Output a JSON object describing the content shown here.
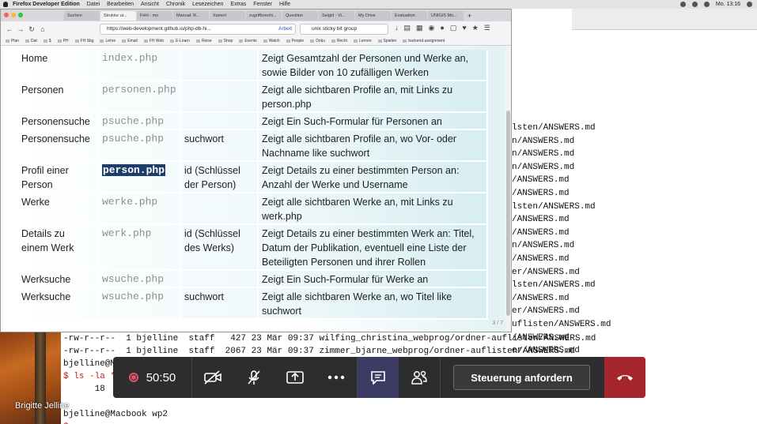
{
  "menubar": {
    "app": "Firefox Developer Edition",
    "items": [
      "Datei",
      "Bearbeiten",
      "Ansicht",
      "Chronik",
      "Lesezeichen",
      "Extras",
      "Fenster",
      "Hilfe"
    ],
    "clock": "Mo. 13:16"
  },
  "browser": {
    "tabs": [
      "Suchen",
      "Struktur ui...",
      "Fehl - mo",
      "Manual: R...",
      "Xameri",
      "zugriffsrecht...",
      "Question",
      "Selgid - Vi...",
      "My Drive",
      "Evaluation",
      "UNIGIS Mo..."
    ],
    "url": "https://web-development.github.io/php-db-hi...",
    "url_tag": "Arbeit",
    "search": "unix sticky bit group",
    "bookmarks": [
      "Plan",
      "Dat",
      "$",
      "PH",
      "FH Sbg",
      "Lehre",
      "Email",
      "FH Web",
      "E-Learn",
      "Reise",
      "Shop",
      "Events",
      "Watch",
      "People",
      "Doku",
      "Recht",
      "Lernen",
      "Spielen",
      "backend-assignment"
    ],
    "page_number": "3 / 7",
    "table": [
      {
        "page": "Home",
        "file": "index.php",
        "param": "",
        "desc": "Zeigt Gesamtzahl der Personen und Werke an, sowie Bilder von 10 zufälligen Werken"
      },
      {
        "page": "Personen",
        "file": "personen.php",
        "param": "",
        "desc": "Zeigt alle sichtbaren Profile an, mit Links zu person.php"
      },
      {
        "page": "Personensuche",
        "file": "psuche.php",
        "param": "",
        "desc": "Zeigt Ein Such-Formular für Personen an"
      },
      {
        "page": "Personensuche",
        "file": "psuche.php",
        "param": "suchwort",
        "desc": "Zeigt alle sichtbaren Profile an, wo Vor- oder Nachname like suchwort"
      },
      {
        "page": "Profil einer Person",
        "file": "person.php",
        "param": "id (Schlüssel der Person)",
        "desc": "Zeigt Details zu einer bestimmten Person an: Anzahl der Werke und Username"
      },
      {
        "page": "Werke",
        "file": "werke.php",
        "param": "",
        "desc": "Zeigt alle sichtbaren Werke an, mit Links zu werk.php"
      },
      {
        "page": "Details zu einem Werk",
        "file": "werk.php",
        "param": "id (Schlüssel des Werks)",
        "desc": "Zeigt Details zu einer bestimmten Werk an: Titel, Datum der Publikation, eventuell eine Liste der Beteiligten Personen und ihrer Rollen"
      },
      {
        "page": "Werksuche",
        "file": "wsuche.php",
        "param": "",
        "desc": "Zeigt Ein Such-Formular für Werke an"
      },
      {
        "page": "Werksuche",
        "file": "wsuche.php",
        "param": "suchwort",
        "desc": "Zeigt alle sichtbaren Werke an, wo Titel like suchwort"
      }
    ]
  },
  "terminal": {
    "lines": [
      "lsten/ANSWERS.md",
      "n/ANSWERS.md",
      "n/ANSWERS.md",
      "n/ANSWERS.md",
      "/ANSWERS.md",
      "/ANSWERS.md",
      "lsten/ANSWERS.md",
      "/ANSWERS.md",
      "/ANSWERS.md",
      "n/ANSWERS.md",
      "/ANSWERS.md",
      "er/ANSWERS.md",
      "lsten/ANSWERS.md",
      "/ANSWERS.md",
      "er/ANSWERS.md",
      "uflisten/ANSWERS.md",
      "/ANSWERS.md",
      "er/ANSWERS.md"
    ],
    "bottom_lines": [
      "-rw-r--r--  1 bjelline  staff   427 23 Mär 09:37 wilfing_christina_webprog/ordner-auflisten/ANSWERS.md",
      "-rw-r--r--  1 bjelline  staff  2067 23 Mär 09:37 zimmer_bjarne_webprog/ordner-auflisten/ANSWERS.md",
      "bjelline@Macbook wp2",
      "$ ls -la *",
      "      18",
      "",
      "bjelline@Macbook wp2",
      "$"
    ]
  },
  "meeting": {
    "participant": "Brigitte Jelline",
    "timer": "50:50",
    "request_control": "Steuerung anfordern",
    "icons": [
      "record-icon",
      "camera-off-icon",
      "mic-off-icon",
      "share-icon",
      "more-icon",
      "chat-icon",
      "participants-icon",
      "hangup-icon"
    ]
  },
  "colors": {
    "selection": "#1f3d6b",
    "hangup": "#a4262c",
    "record": "#e05264",
    "chat_active": "#3c3b63"
  }
}
